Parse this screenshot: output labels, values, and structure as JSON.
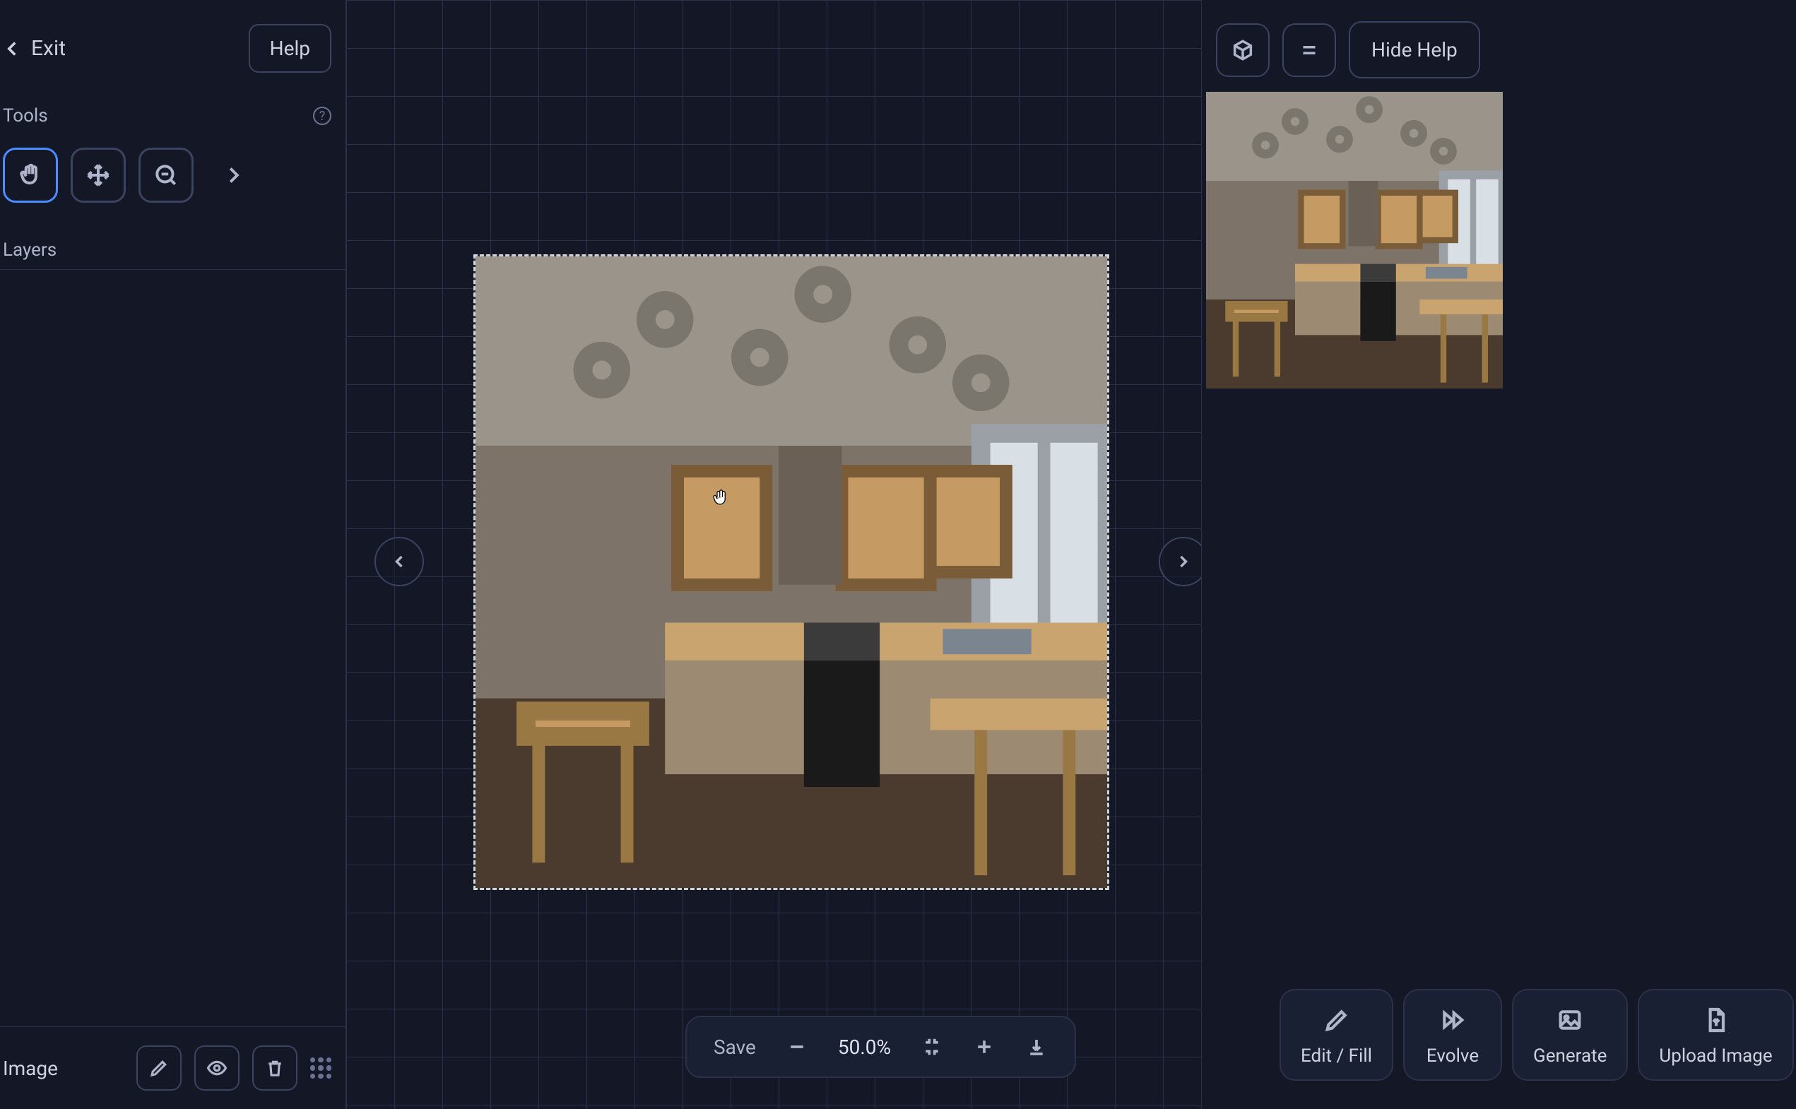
{
  "topbar": {
    "exit_label": "Exit",
    "help_label": "Help"
  },
  "sections": {
    "tools_label": "Tools",
    "layers_label": "Layers",
    "image_label": "Image"
  },
  "zoom": {
    "save_label": "Save",
    "percent": "50.0%"
  },
  "right": {
    "hide_help_label": "Hide Help"
  },
  "actions": {
    "edit_fill": "Edit / Fill",
    "evolve": "Evolve",
    "generate": "Generate",
    "upload": "Upload Image"
  },
  "tools": [
    "hand",
    "move",
    "zoom-out",
    "more"
  ],
  "icons": {
    "hand": "hand-icon",
    "move": "move-icon",
    "zoom_out": "zoom-out-icon",
    "chev_right": "chevron-right-icon",
    "chev_left": "chevron-left-icon",
    "question": "question-icon",
    "pencil": "pencil-icon",
    "eye": "eye-icon",
    "trash": "trash-icon",
    "drag": "drag-handle-icon",
    "minus": "minus-icon",
    "plus": "plus-icon",
    "collapse": "collapse-icon",
    "download": "download-icon",
    "cube": "cube-icon",
    "menu": "menu-icon",
    "fast_forward": "fast-forward-icon",
    "image": "image-icon",
    "file_upload": "file-upload-icon"
  }
}
